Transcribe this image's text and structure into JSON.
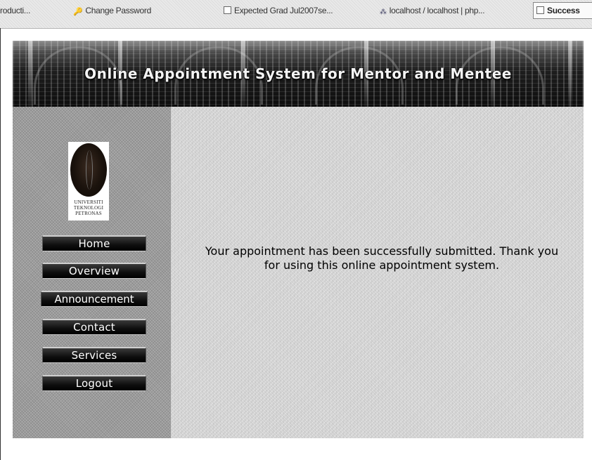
{
  "browser": {
    "tabs": [
      {
        "label": "roducti...",
        "icon": "page-icon"
      },
      {
        "label": "Change Password",
        "icon": "key-icon"
      },
      {
        "label": "Expected Grad Jul2007se...",
        "icon": "page-icon"
      },
      {
        "label": "localhost / localhost | php...",
        "icon": "php-icon"
      },
      {
        "label": "Success",
        "icon": "page-icon"
      }
    ]
  },
  "header": {
    "title": "Online Appointment System for Mentor and Mentee"
  },
  "logo": {
    "line1": "UNIVERSITI",
    "line2": "TEKNOLOGI",
    "line3": "PETRONAS"
  },
  "nav": {
    "items": [
      {
        "label": "Home"
      },
      {
        "label": "Overview"
      },
      {
        "label": "Announcement"
      },
      {
        "label": "Contact"
      },
      {
        "label": "Services"
      },
      {
        "label": "Logout"
      }
    ]
  },
  "main": {
    "message": "Your appointment has been successfully submitted. Thank you for using this online appointment system."
  },
  "colors": {
    "banner": "#1a1a1a",
    "nav_button": "#111111",
    "content_bg": "#d6d6d6",
    "sidebar_bg": "#9c9c9c"
  }
}
